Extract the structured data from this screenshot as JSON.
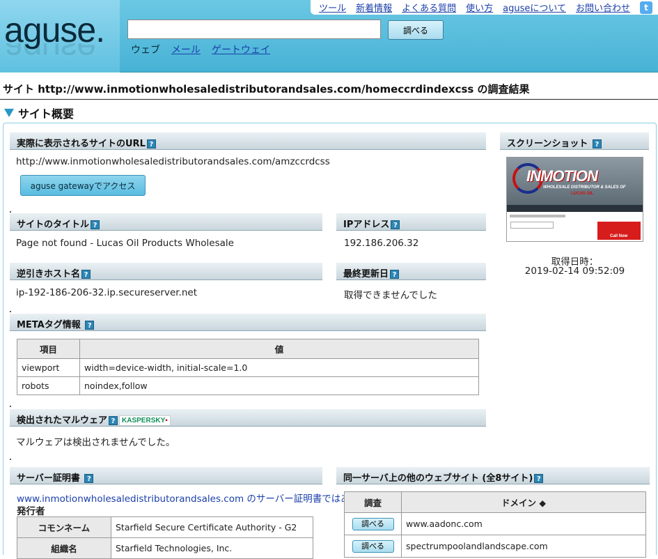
{
  "header": {
    "logo": "aguse.",
    "top_links": [
      "ツール",
      "新着情報",
      "よくある質問",
      "使い方",
      "aguseについて",
      "お問い合わせ"
    ],
    "search_value": "",
    "search_button": "調べる",
    "search_tabs": [
      "ウェブ",
      "メール",
      "ゲートウェイ"
    ]
  },
  "result_title": "サイト http://www.inmotionwholesaledistributorandsales.com/homeccrdindexcss の調査結果",
  "section_title": "サイト概要",
  "boxes": {
    "actual_url": {
      "label": "実際に表示されるサイトのURL",
      "value": "http://www.inmotionwholesaledistributorandsales.com/amzccrdcss",
      "button": "aguse gatewayでアクセス"
    },
    "screenshot": {
      "label": "スクリーンショット",
      "date_label": "取得日時：",
      "date_value": "2019-02-14 09:52:09"
    },
    "site_title": {
      "label": "サイトのタイトル",
      "value": "Page not found - Lucas Oil Products Wholesale"
    },
    "ip": {
      "label": "IPアドレス",
      "value": "192.186.206.32"
    },
    "reverse_host": {
      "label": "逆引きホスト名",
      "value": "ip-192-186-206-32.ip.secureserver.net"
    },
    "last_updated": {
      "label": "最終更新日",
      "value": "取得できませんでした"
    },
    "meta": {
      "label": "METAタグ情報",
      "col_key": "項目",
      "col_value": "値",
      "rows": [
        {
          "k": "viewport",
          "v": "width=device-width, initial-scale=1.0"
        },
        {
          "k": "robots",
          "v": "noindex,follow"
        }
      ]
    },
    "malware": {
      "label": "検出されたマルウェア",
      "value": "マルウェアは検出されませんでした。"
    },
    "cert": {
      "label": "サーバー証明書",
      "link": "www.inmotionwholesaledistributorandsales.com のサーバー証明書ではあ",
      "issuer": "発行者",
      "rows": [
        {
          "k": "コモンネーム",
          "v": "Starfield Secure Certificate Authority - G2"
        },
        {
          "k": "組織名",
          "v": "Starfield Technologies, Inc."
        }
      ]
    },
    "other_sites": {
      "label": "同一サーバ上の他のウェブサイト (全8サイト)",
      "col_check": "調査",
      "col_domain": "ドメイン ◆",
      "button": "調べる",
      "rows": [
        "www.aadonc.com",
        "spectrumpoolandlandscape.com"
      ]
    }
  },
  "thumbnail": {
    "logo": "INMOTION",
    "sub": "WHOLESALE DISTRIBUTOR & SALES OF",
    "brand": "LUCAS OIL",
    "ad": "Call Now"
  },
  "icons": {
    "help": "?",
    "twitter": "t",
    "kaspersky": "KASPERSKY"
  },
  "colors": {
    "header_bg": "#5bbfdd",
    "link": "#1a3faa",
    "accent": "#2a97c6"
  }
}
